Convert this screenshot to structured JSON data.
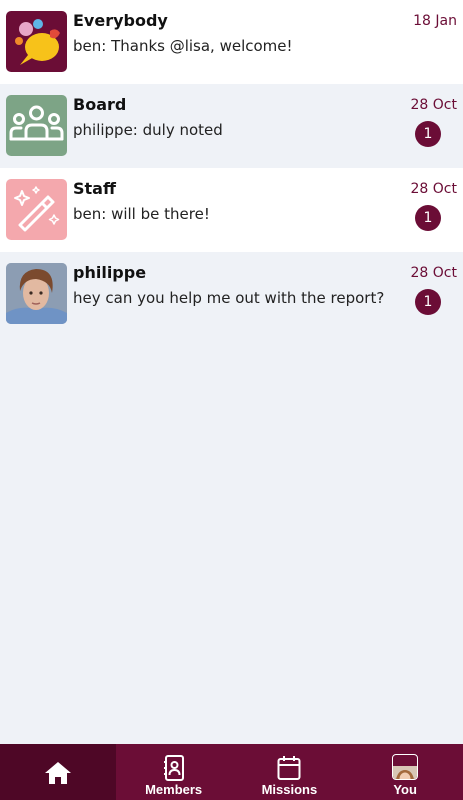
{
  "conversations": [
    {
      "name": "Everybody",
      "preview": "ben: Thanks @lisa, welcome!",
      "date": "18 Jan",
      "unread": null,
      "avatar_icon": "colorful-speech-bubbles-icon",
      "avatar_color": "#6b0d36"
    },
    {
      "name": "Board",
      "preview": "philippe: duly noted",
      "date": "28 Oct",
      "unread": "1",
      "avatar_icon": "group-people-icon",
      "avatar_color": "#7da486"
    },
    {
      "name": "Staff",
      "preview": "ben: will be there!",
      "date": "28 Oct",
      "unread": "1",
      "avatar_icon": "magic-wand-icon",
      "avatar_color": "#f4a8ad"
    },
    {
      "name": "philippe",
      "preview": "hey can you help me out with the report?",
      "date": "28 Oct",
      "unread": "1",
      "avatar_icon": "user-photo",
      "avatar_color": "#b59a8a"
    }
  ],
  "tabbar": {
    "home_icon": "home-icon",
    "members_label": "Members",
    "missions_label": "Missions",
    "you_label": "You",
    "bg_color": "#6b0d36",
    "active_color": "#4e0726"
  }
}
